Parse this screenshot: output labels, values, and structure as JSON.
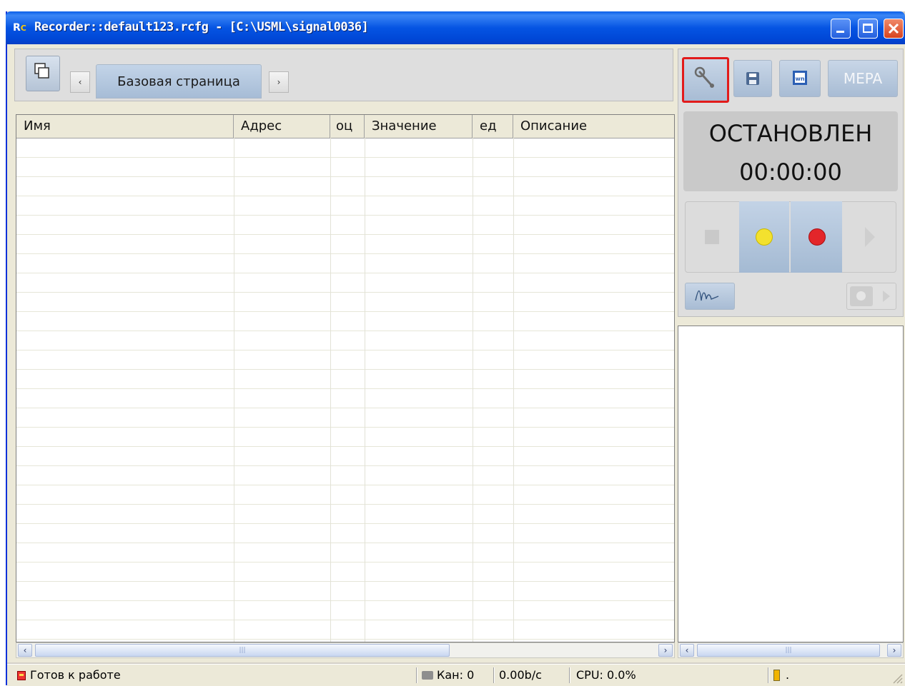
{
  "window": {
    "icon_text_r": "R",
    "icon_text_c": "C",
    "title": "Recorder::default123.rcfg - [C:\\USML\\signal0036]",
    "controls": [
      "minimize-icon",
      "maximize-icon",
      "close-icon"
    ]
  },
  "toolbar": {
    "page_tab_label": "Базовая страница",
    "prev_arrow": "‹",
    "next_arrow": "›"
  },
  "grid": {
    "columns": [
      "Имя",
      "Адрес",
      "оц",
      "Значение",
      "ед",
      "Описание"
    ],
    "rows": []
  },
  "right_panel": {
    "buttons": [
      {
        "name": "settings",
        "icon": "wrench-icon",
        "selected": true
      },
      {
        "name": "save",
        "icon": "floppy-icon"
      },
      {
        "name": "word-export",
        "icon": "word-icon"
      },
      {
        "name": "mera",
        "label": "MEPA"
      }
    ],
    "state_label": "ОСТАНОВЛЕН",
    "timer": "00:00:00",
    "controls": [
      "stop-icon",
      "yellow-record-icon",
      "red-record-icon",
      "play-icon"
    ]
  },
  "scroll": {
    "left_arrow": "‹",
    "right_arrow": "›",
    "thumb_grip": "|||"
  },
  "status_bar": {
    "ready_text": "Готов к работе",
    "channels": "Кан: 0",
    "rate": "0.00b/c",
    "cpu": "CPU: 0.0%",
    "extra": "."
  },
  "colors": {
    "title_blue": "#0554e3",
    "selection_red": "#e21b1b",
    "record_yellow": "#f3e12e",
    "record_red": "#e3262a"
  }
}
